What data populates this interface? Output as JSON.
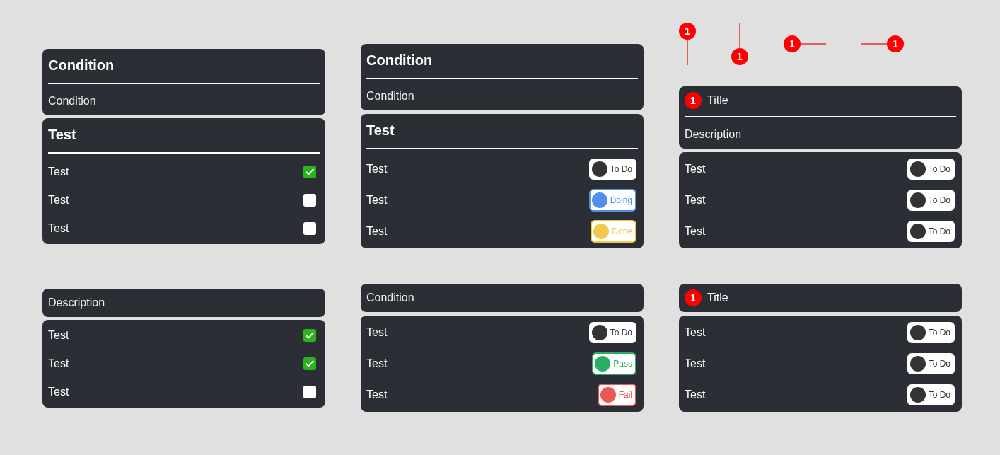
{
  "sections": [
    {
      "header": {
        "kind": "heading",
        "title": "Condition",
        "description": "Condition"
      },
      "list": {
        "title": "Test",
        "items": [
          {
            "kind": "checkbox",
            "label": "Test",
            "checked": true
          },
          {
            "kind": "checkbox",
            "label": "Test",
            "checked": false
          },
          {
            "kind": "checkbox",
            "label": "Test",
            "checked": false
          }
        ]
      }
    },
    {
      "header": {
        "kind": "heading",
        "title": "Condition",
        "description": "Condition"
      },
      "list": {
        "title": "Test",
        "items": [
          {
            "kind": "chip",
            "label": "Test",
            "status": "To Do",
            "color": "#333333"
          },
          {
            "kind": "outlinedchip",
            "label": "Test",
            "status": "Doing",
            "color": "#4f8ff0"
          },
          {
            "kind": "outlinedchip",
            "label": "Test",
            "status": "Done",
            "color": "#f2c94c"
          }
        ]
      }
    },
    {
      "markers": [
        {
          "kind": "down",
          "label": "1"
        },
        {
          "kind": "up",
          "label": "1"
        },
        {
          "kind": "right",
          "label": "1"
        },
        {
          "kind": "left",
          "label": "1"
        }
      ],
      "header": {
        "kind": "numbered",
        "badge": "1",
        "title": "Title",
        "description": "Description"
      },
      "list": {
        "items": [
          {
            "kind": "chip",
            "label": "Test",
            "status": "To Do",
            "color": "#333333"
          },
          {
            "kind": "chip",
            "label": "Test",
            "status": "To Do",
            "color": "#333333"
          },
          {
            "kind": "chip",
            "label": "Test",
            "status": "To Do",
            "color": "#333333"
          }
        ]
      }
    },
    {
      "header": {
        "kind": "plain",
        "description": "Description"
      },
      "list": {
        "items": [
          {
            "kind": "checkbox",
            "label": "Test",
            "checked": true
          },
          {
            "kind": "checkbox",
            "label": "Test",
            "checked": true
          },
          {
            "kind": "checkbox",
            "label": "Test",
            "checked": false
          }
        ]
      }
    },
    {
      "header": {
        "kind": "plain",
        "description": "Condition"
      },
      "list": {
        "items": [
          {
            "kind": "chip",
            "label": "Test",
            "status": "To Do",
            "color": "#333333"
          },
          {
            "kind": "outlinedchip",
            "label": "Test",
            "status": "Pass",
            "color": "#27ae60"
          },
          {
            "kind": "outlinedchip",
            "label": "Test",
            "status": "Fail",
            "color": "#eb5757"
          }
        ]
      }
    },
    {
      "header": {
        "kind": "numbered",
        "badge": "1",
        "title": "Title"
      },
      "list": {
        "items": [
          {
            "kind": "chip",
            "label": "Test",
            "status": "To Do",
            "color": "#333333"
          },
          {
            "kind": "chip",
            "label": "Test",
            "status": "To Do",
            "color": "#333333"
          },
          {
            "kind": "chip",
            "label": "Test",
            "status": "To Do",
            "color": "#333333"
          }
        ]
      }
    }
  ]
}
